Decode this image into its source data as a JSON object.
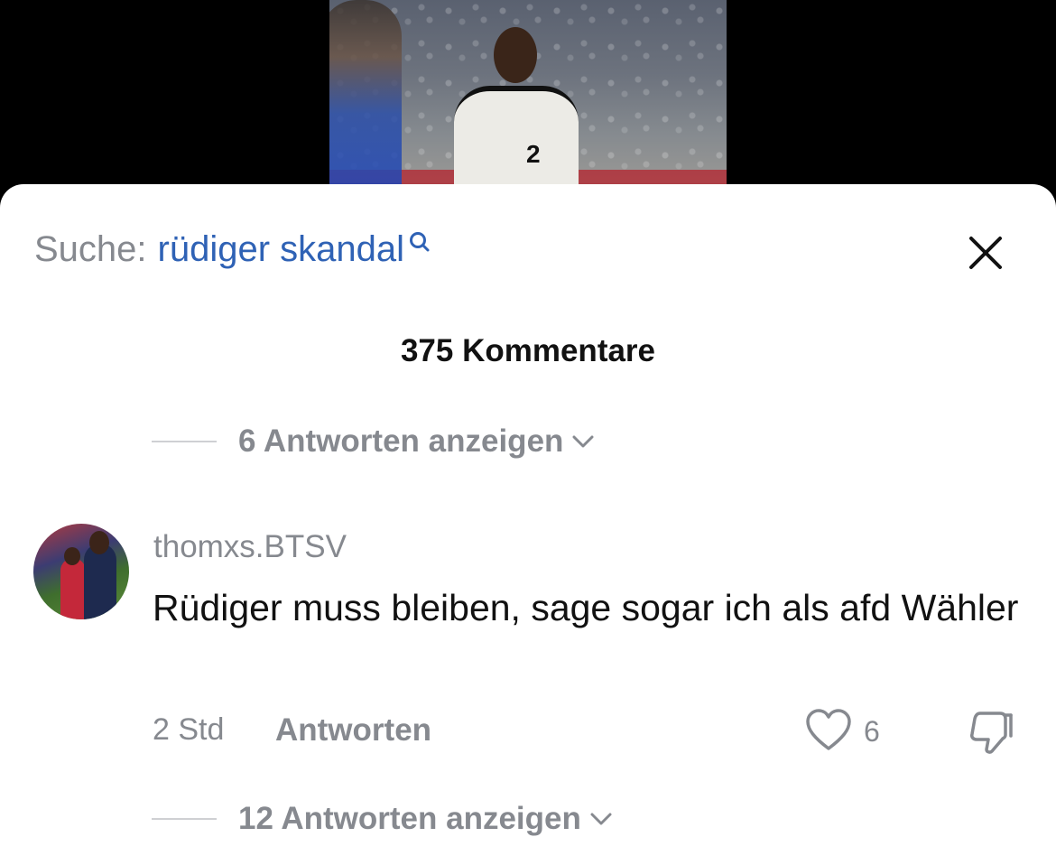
{
  "search": {
    "prefix": "Suche:",
    "term": "rüdiger skandal"
  },
  "icons": {
    "search": "search-icon",
    "close": "close-icon",
    "chevron": "chevron-down-icon",
    "like": "heart-icon",
    "dislike": "thumbs-down-icon"
  },
  "colors": {
    "search_term": "#2f62b5",
    "muted": "#86898f",
    "text": "#111111"
  },
  "comments": {
    "count_label": "375 Kommentare",
    "replies_above": "6 Antworten anzeigen",
    "items": [
      {
        "username": "thomxs.BTSV",
        "text": "Rüdiger muss bleiben, sage sogar ich als afd Wähler",
        "time": "2 Std",
        "reply_label": "Antworten",
        "likes": "6",
        "replies_label": "12 Antworten anzeigen"
      }
    ]
  }
}
